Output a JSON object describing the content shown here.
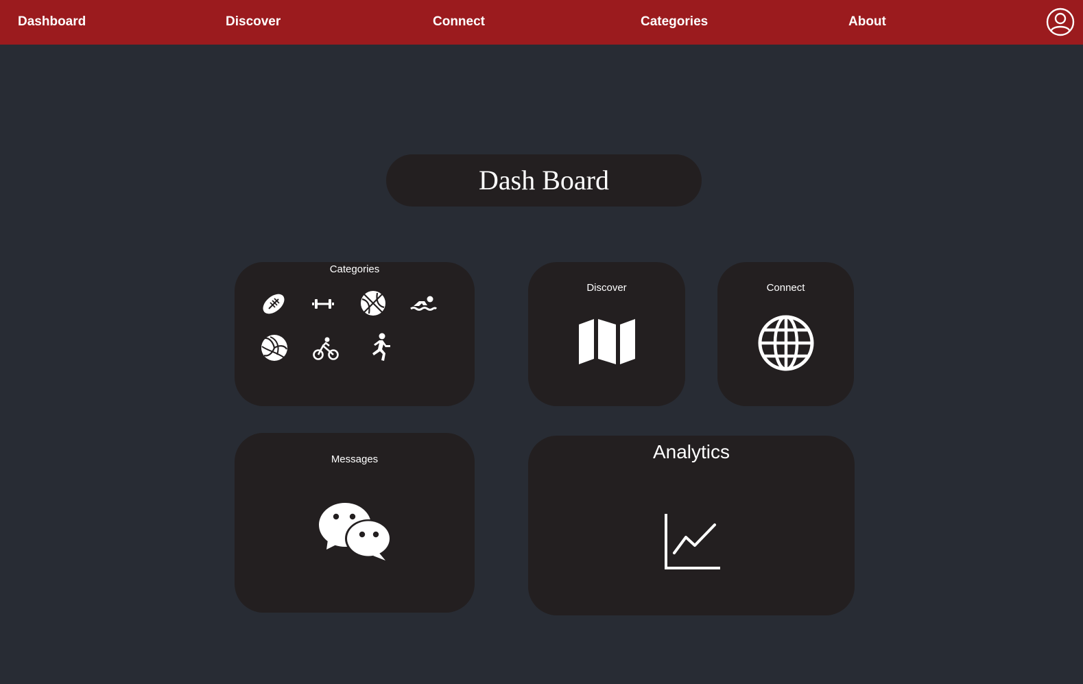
{
  "nav": {
    "items": [
      {
        "label": "Dashboard"
      },
      {
        "label": "Discover"
      },
      {
        "label": "Connect"
      },
      {
        "label": "Categories"
      },
      {
        "label": "About"
      }
    ],
    "avatar_icon": "user-circle-icon"
  },
  "page": {
    "title": "Dash Board"
  },
  "cards": {
    "categories": {
      "label": "Categories",
      "icons": [
        "american-football-icon",
        "dumbbell-icon",
        "basketball-icon",
        "swimming-icon",
        "volleyball-icon",
        "cycling-icon",
        "running-icon"
      ]
    },
    "discover": {
      "label": "Discover",
      "icon": "map-icon"
    },
    "connect": {
      "label": "Connect",
      "icon": "globe-icon"
    },
    "messages": {
      "label": "Messages",
      "icon": "chat-bubbles-icon"
    },
    "analytics": {
      "label": "Analytics",
      "icon": "line-chart-icon"
    }
  },
  "colors": {
    "topbar": "#9b1b1e",
    "background": "#282c34",
    "card": "#231f20",
    "text": "#ffffff"
  }
}
